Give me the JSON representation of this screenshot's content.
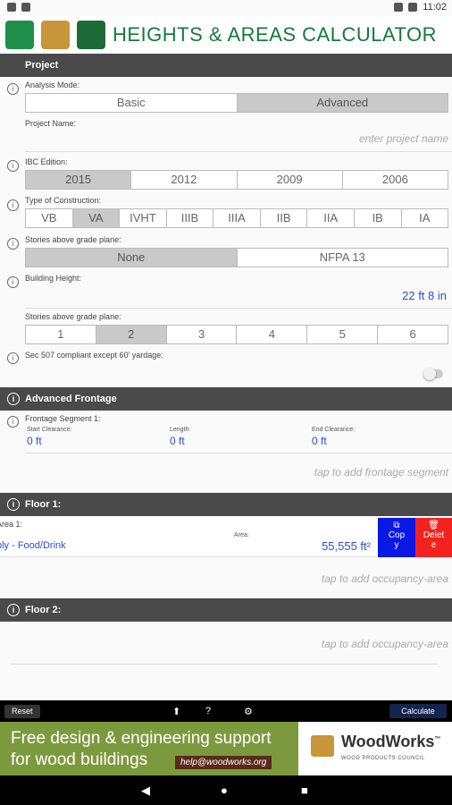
{
  "status": {
    "time": "11:02"
  },
  "header": {
    "title": "HEIGHTS & AREAS CALCULATOR"
  },
  "project": {
    "section_title": "Project",
    "analysis_mode_label": "Analysis Mode:",
    "analysis_modes": [
      "Basic",
      "Advanced"
    ],
    "project_name_label": "Project Name:",
    "project_name_placeholder": "enter project name",
    "ibc_label": "IBC Edition:",
    "ibc_editions": [
      "2015",
      "2012",
      "2009",
      "2006"
    ],
    "construction_label": "Type of Construction:",
    "construction_types": [
      "VB",
      "VA",
      "IVHT",
      "IIIB",
      "IIIA",
      "IIB",
      "IIA",
      "IB",
      "IA"
    ],
    "sprinkler_label": "Stories above grade plane:",
    "sprinkler_options": [
      "None",
      "NFPA 13"
    ],
    "building_height_label": "Building Height:",
    "building_height_value": "22 ft 8 in",
    "stories_label": "Stories above grade plane:",
    "stories_options": [
      "1",
      "2",
      "3",
      "4",
      "5",
      "6"
    ],
    "sec507_label": "Sec 507 compliant except 60' yardage:"
  },
  "frontage": {
    "section_title": "Advanced Frontage",
    "segment_label": "Frontage Segment 1:",
    "start_label": "Start Clearance:",
    "start_value": "0 ft",
    "length_label": "Length:",
    "length_value": "0 ft",
    "end_label": "End Clearance:",
    "end_value": "0 ft",
    "add_placeholder": "tap to add frontage segment"
  },
  "floor1": {
    "section_title": "Floor 1:",
    "area_label": "Area 1:",
    "occupancy": "bly - Food/Drink",
    "area_small_label": "Area:",
    "area_value": "55,555 ft²",
    "copy_label": "Cop y",
    "delete_label": "Delet e",
    "add_placeholder": "tap to add occupancy-area"
  },
  "floor2": {
    "section_title": "Floor 2:",
    "add_placeholder": "tap to add occupancy-area"
  },
  "toolbar": {
    "reset_label": "Reset",
    "calculate_label": "Calculate"
  },
  "ad": {
    "line1": "Free design & engineering support",
    "line2": "for wood buildings",
    "email": "help@woodworks.org",
    "brand": "WoodWorks",
    "tm": "™",
    "sub": "WOOD PRODUCTS COUNCIL"
  }
}
